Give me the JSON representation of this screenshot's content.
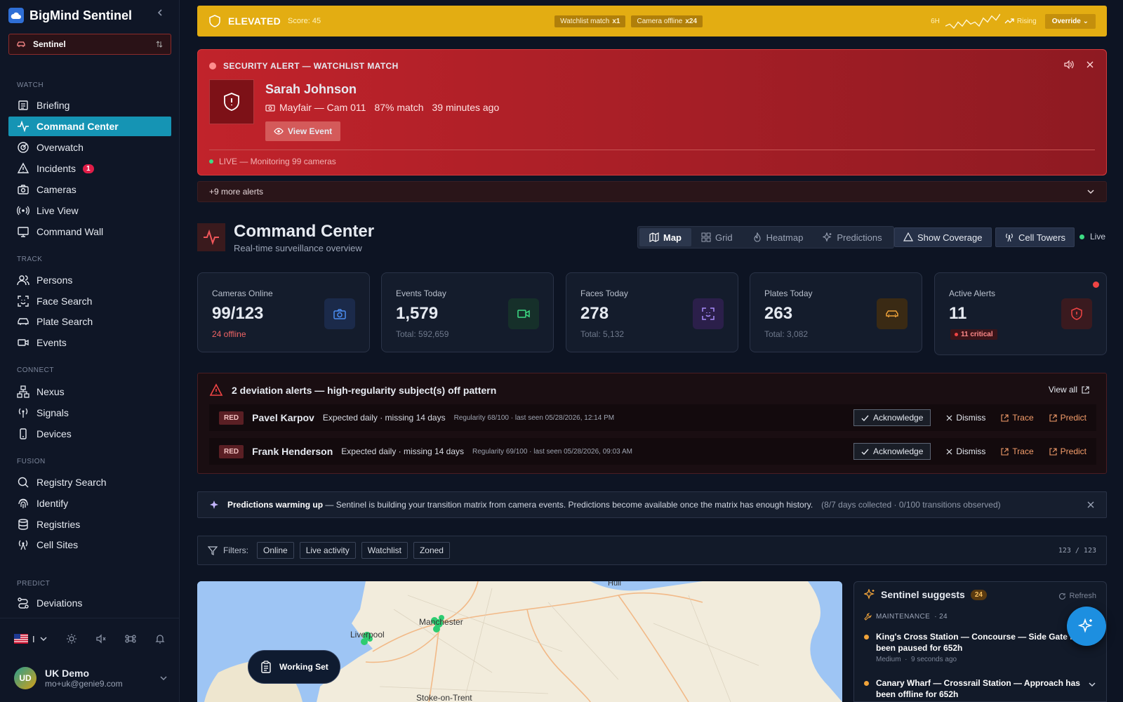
{
  "app": {
    "name": "BigMind Sentinel"
  },
  "workspace": {
    "label": "Sentinel"
  },
  "nav": {
    "sections": {
      "watch": "WATCH",
      "track": "TRACK",
      "connect": "CONNECT",
      "fusion": "FUSION",
      "predict": "PREDICT"
    },
    "items": {
      "briefing": "Briefing",
      "command_center": "Command Center",
      "overwatch": "Overwatch",
      "incidents": "Incidents",
      "incidents_badge": "1",
      "cameras": "Cameras",
      "live_view": "Live View",
      "command_wall": "Command Wall",
      "persons": "Persons",
      "face_search": "Face Search",
      "plate_search": "Plate Search",
      "events": "Events",
      "nexus": "Nexus",
      "signals": "Signals",
      "devices": "Devices",
      "registry_search": "Registry Search",
      "identify": "Identify",
      "registries": "Registries",
      "cell_sites": "Cell Sites",
      "deviations": "Deviations"
    }
  },
  "user": {
    "initials": "UD",
    "name": "UK Demo",
    "email": "mo+uk@genie9.com",
    "language_divider": "I"
  },
  "threat": {
    "level": "ELEVATED",
    "score": "Score: 45",
    "chips": [
      {
        "label": "Watchlist match",
        "count": "x1"
      },
      {
        "label": "Camera offline",
        "count": "x24"
      }
    ],
    "window": "6H",
    "trend": "Rising",
    "override": "Override",
    "sparkline": [
      2,
      3,
      1,
      4,
      2,
      5,
      3,
      4,
      2,
      6,
      4,
      7,
      5,
      8
    ]
  },
  "alert": {
    "title": "SECURITY ALERT — WATCHLIST MATCH",
    "name": "Sarah Johnson",
    "location": "Mayfair — Cam 011",
    "match": "87% match",
    "time": "39 minutes ago",
    "view_button": "View Event",
    "live": "LIVE — Monitoring 99 cameras"
  },
  "more_alerts": "+9 more alerts",
  "command_center": {
    "title": "Command Center",
    "subtitle": "Real-time surveillance overview",
    "views": [
      "Map",
      "Grid",
      "Heatmap",
      "Predictions"
    ],
    "show_coverage": "Show Coverage",
    "cell_towers": "Cell Towers",
    "live": "Live"
  },
  "stats": [
    {
      "label": "Cameras Online",
      "value": "99/123",
      "sub": "24 offline",
      "color": "#4b8cf0"
    },
    {
      "label": "Events Today",
      "value": "1,579",
      "sub": "Total: 592,659",
      "color": "#3ddc84"
    },
    {
      "label": "Faces Today",
      "value": "278",
      "sub": "Total: 5,132",
      "color": "#a78bfa"
    },
    {
      "label": "Plates Today",
      "value": "263",
      "sub": "Total: 3,082",
      "color": "#f0a33a"
    },
    {
      "label": "Active Alerts",
      "value": "11",
      "sub": "11 critical",
      "color": "#ef4444"
    }
  ],
  "deviations": {
    "title": "2 deviation alerts — high-regularity subject(s) off pattern",
    "view_all": "View all",
    "rows": [
      {
        "tag": "RED",
        "name": "Pavel Karpov",
        "expected": "Expected daily · missing 14 days",
        "regularity": "Regularity 68/100 · last seen 05/28/2026, 12:14 PM"
      },
      {
        "tag": "RED",
        "name": "Frank Henderson",
        "expected": "Expected daily · missing 14 days",
        "regularity": "Regularity 69/100 · last seen 05/28/2026, 09:03 AM"
      }
    ],
    "actions": {
      "ack": "Acknowledge",
      "dismiss": "Dismiss",
      "trace": "Trace",
      "predict": "Predict"
    }
  },
  "predictions_banner": {
    "title": "Predictions warming up",
    "text": " — Sentinel is building your transition matrix from camera events. Predictions become available once the matrix has enough history.",
    "progress": "(8/7 days collected · 0/100 transitions observed)"
  },
  "filters": {
    "label": "Filters:",
    "chips": [
      "Online",
      "Live activity",
      "Watchlist",
      "Zoned"
    ],
    "count": "123 / 123"
  },
  "map": {
    "labels": {
      "hull": "Hull",
      "liverpool": "Liverpool",
      "manchester": "Manchester",
      "stoke": "Stoke-on-Trent"
    },
    "working_set": "Working Set"
  },
  "suggestions": {
    "title": "Sentinel suggests",
    "count": "24",
    "refresh": "Refresh",
    "section": "MAINTENANCE",
    "section_count": "· 24",
    "items": [
      {
        "title": "King's Cross Station — Concourse — Side Gate has been paused for 652h",
        "severity": "Medium",
        "time": "9 seconds ago"
      },
      {
        "title": "Canary Wharf — Crossrail Station — Approach has been offline for 652h"
      }
    ]
  }
}
